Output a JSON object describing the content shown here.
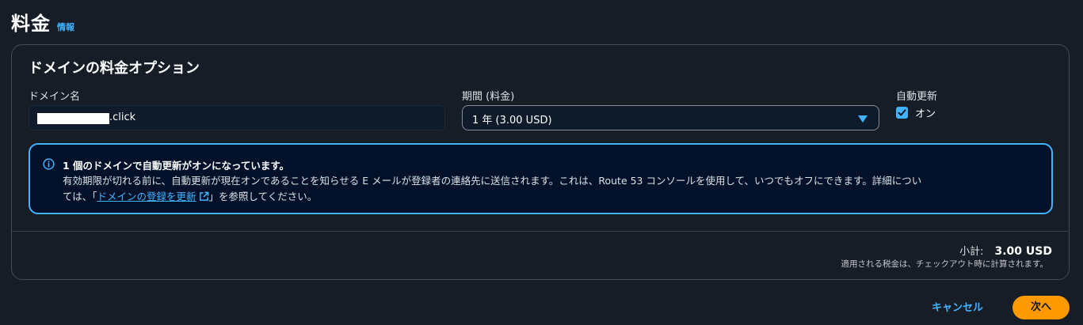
{
  "header": {
    "title": "料金",
    "info_link": "情報"
  },
  "panel": {
    "title": "ドメインの料金オプション",
    "domain": {
      "label": "ドメイン名",
      "suffix": ".click"
    },
    "period": {
      "label": "期間 (料金)",
      "value": "1 年 (3.00 USD)"
    },
    "auto_renew": {
      "label": "自動更新",
      "checkbox_label": "オン",
      "checked": true
    },
    "alert": {
      "icon": "info-icon",
      "title": "1 個のドメインで自動更新がオンになっています。",
      "body_line1": "有効期限が切れる前に、自動更新が現在オンであることを知らせる E メールが登録者の連絡先に送信されます。これは、Route 53 コンソールを使用して、いつでもオフにできます。詳細につい",
      "body_prefix": "ては、「",
      "link_text": "ドメインの登録を更新",
      "body_suffix": "」を参照してください。"
    },
    "subtotal": {
      "label": "小計:",
      "value": "3.00 USD",
      "tax_note": "適用される税金は、チェックアウト時に計算されます。"
    }
  },
  "footer": {
    "cancel_label": "キャンセル",
    "next_label": "次へ"
  },
  "colors": {
    "background": "#161d26",
    "accent": "#42b4ff",
    "primary_button": "#ff9900"
  }
}
